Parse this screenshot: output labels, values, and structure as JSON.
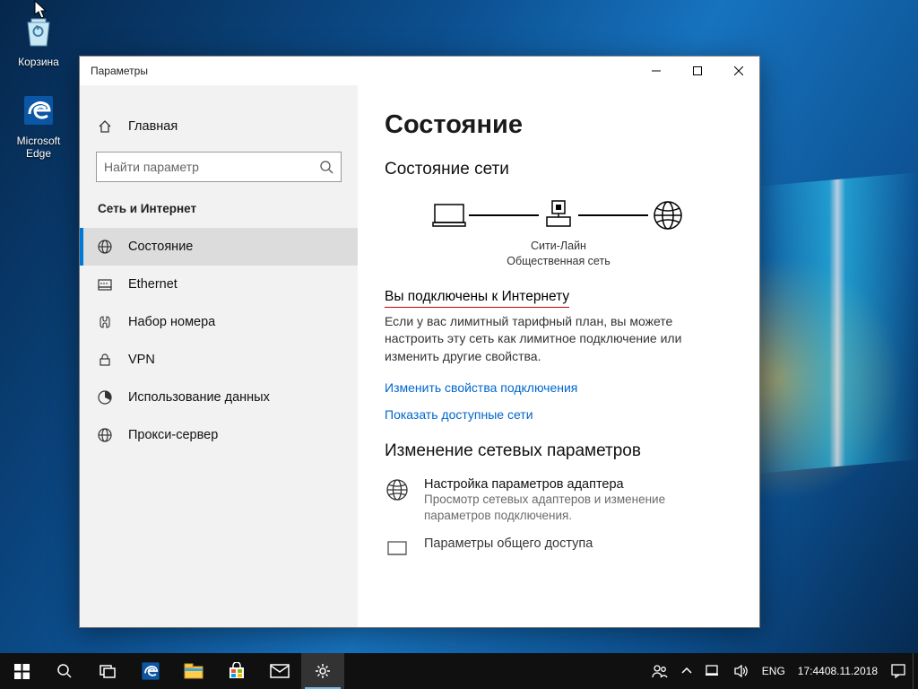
{
  "desktop": {
    "recycle_bin": "Корзина",
    "edge": "Microsoft Edge"
  },
  "window": {
    "title": "Параметры",
    "sidebar": {
      "home": "Главная",
      "search_placeholder": "Найти параметр",
      "section": "Сеть и Интернет",
      "items": [
        {
          "label": "Состояние"
        },
        {
          "label": "Ethernet"
        },
        {
          "label": "Набор номера"
        },
        {
          "label": "VPN"
        },
        {
          "label": "Использование данных"
        },
        {
          "label": "Прокси-сервер"
        }
      ]
    },
    "content": {
      "title": "Состояние",
      "section1": "Состояние сети",
      "diag_label1": "Сити-Лайн",
      "diag_label2": "Общественная сеть",
      "subhead": "Вы подключены к Интернету",
      "desc": "Если у вас лимитный тарифный план, вы можете настроить эту сеть как лимитное подключение или изменить другие свойства.",
      "link1": "Изменить свойства подключения",
      "link2": "Показать доступные сети",
      "section2": "Изменение сетевых параметров",
      "param1_title": "Настройка параметров адаптера",
      "param1_desc": "Просмотр сетевых адаптеров и изменение параметров подключения.",
      "param2_title": "Параметры общего доступа"
    }
  },
  "taskbar": {
    "lang": "ENG",
    "time": "17:44",
    "date": "08.11.2018"
  }
}
